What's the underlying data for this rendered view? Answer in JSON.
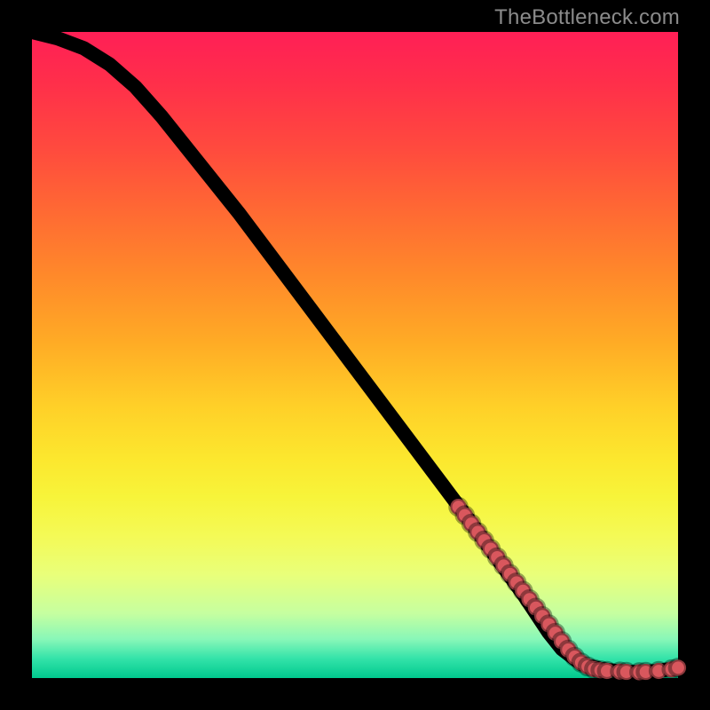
{
  "watermark": "TheBottleneck.com",
  "chart_data": {
    "type": "line",
    "title": "",
    "xlabel": "",
    "ylabel": "",
    "xlim": [
      0,
      100
    ],
    "ylim": [
      0,
      100
    ],
    "grid": false,
    "series": [
      {
        "name": "curve",
        "kind": "line",
        "x": [
          0,
          4,
          8,
          12,
          16,
          20,
          26,
          32,
          38,
          44,
          50,
          56,
          62,
          68,
          72,
          76,
          78,
          80,
          82,
          85,
          88,
          91,
          94,
          97,
          100
        ],
        "y": [
          100,
          99,
          97.5,
          95,
          91.5,
          87,
          79.5,
          72,
          64,
          56,
          48,
          40,
          32,
          24,
          18.5,
          13,
          10,
          7,
          4.5,
          2.2,
          1.4,
          1.0,
          0.9,
          1.1,
          1.6
        ]
      },
      {
        "name": "points",
        "kind": "scatter",
        "x": [
          66,
          67,
          68,
          69,
          70,
          71,
          72,
          73,
          74,
          75,
          76,
          77,
          78,
          79,
          80,
          81,
          82,
          83,
          84,
          85,
          86,
          87,
          88,
          89,
          91,
          92,
          94,
          95,
          97,
          99,
          100
        ],
        "y": [
          26.5,
          25.2,
          23.9,
          22.6,
          21.3,
          20.0,
          18.7,
          17.4,
          16.1,
          14.8,
          13.5,
          12.2,
          10.9,
          9.6,
          8.3,
          7.0,
          5.7,
          4.4,
          3.3,
          2.4,
          1.8,
          1.4,
          1.2,
          1.1,
          1.0,
          0.95,
          0.9,
          0.95,
          1.1,
          1.35,
          1.6
        ]
      }
    ]
  }
}
